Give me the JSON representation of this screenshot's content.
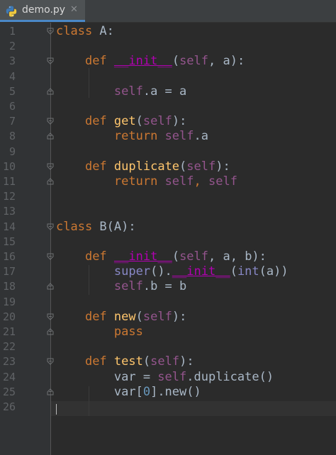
{
  "tab": {
    "filename": "demo.py",
    "close_glyph": "✕",
    "icon": "python-file-icon"
  },
  "editor": {
    "current_line": 26,
    "lines": [
      {
        "n": "1",
        "fold": "start",
        "tokens": [
          {
            "t": "class",
            "c": "kw"
          },
          {
            "t": " A:",
            "c": "tx"
          }
        ]
      },
      {
        "n": "2",
        "fold": "",
        "tokens": []
      },
      {
        "n": "3",
        "fold": "start",
        "tokens": [
          {
            "t": "    ",
            "c": "tx"
          },
          {
            "t": "def",
            "c": "kw"
          },
          {
            "t": " ",
            "c": "tx"
          },
          {
            "t": "__init__",
            "c": "mg",
            "u": true
          },
          {
            "t": "(",
            "c": "tx"
          },
          {
            "t": "self",
            "c": "sf"
          },
          {
            "t": ", a):",
            "c": "tx"
          }
        ]
      },
      {
        "n": "4",
        "fold": "",
        "tokens": []
      },
      {
        "n": "5",
        "fold": "end",
        "tokens": [
          {
            "t": "        ",
            "c": "tx"
          },
          {
            "t": "self",
            "c": "sf"
          },
          {
            "t": ".a = a",
            "c": "tx"
          }
        ]
      },
      {
        "n": "6",
        "fold": "",
        "tokens": []
      },
      {
        "n": "7",
        "fold": "start",
        "tokens": [
          {
            "t": "    ",
            "c": "tx"
          },
          {
            "t": "def",
            "c": "kw"
          },
          {
            "t": " ",
            "c": "tx"
          },
          {
            "t": "get",
            "c": "fn"
          },
          {
            "t": "(",
            "c": "tx"
          },
          {
            "t": "self",
            "c": "sf"
          },
          {
            "t": "):",
            "c": "tx"
          }
        ]
      },
      {
        "n": "8",
        "fold": "end",
        "tokens": [
          {
            "t": "        ",
            "c": "tx"
          },
          {
            "t": "return",
            "c": "kw"
          },
          {
            "t": " ",
            "c": "tx"
          },
          {
            "t": "self",
            "c": "sf"
          },
          {
            "t": ".a",
            "c": "tx"
          }
        ]
      },
      {
        "n": "9",
        "fold": "",
        "tokens": []
      },
      {
        "n": "10",
        "fold": "start",
        "tokens": [
          {
            "t": "    ",
            "c": "tx"
          },
          {
            "t": "def",
            "c": "kw"
          },
          {
            "t": " ",
            "c": "tx"
          },
          {
            "t": "duplicate",
            "c": "fn"
          },
          {
            "t": "(",
            "c": "tx"
          },
          {
            "t": "self",
            "c": "sf"
          },
          {
            "t": "):",
            "c": "tx"
          }
        ]
      },
      {
        "n": "11",
        "fold": "end",
        "tokens": [
          {
            "t": "        ",
            "c": "tx"
          },
          {
            "t": "return",
            "c": "kw"
          },
          {
            "t": " ",
            "c": "tx"
          },
          {
            "t": "self",
            "c": "sf"
          },
          {
            "t": ", ",
            "c": "kw"
          },
          {
            "t": "self",
            "c": "sf"
          }
        ]
      },
      {
        "n": "12",
        "fold": "",
        "tokens": []
      },
      {
        "n": "13",
        "fold": "",
        "tokens": []
      },
      {
        "n": "14",
        "fold": "start",
        "tokens": [
          {
            "t": "class",
            "c": "kw"
          },
          {
            "t": " B(A):",
            "c": "tx"
          }
        ]
      },
      {
        "n": "15",
        "fold": "",
        "tokens": []
      },
      {
        "n": "16",
        "fold": "start",
        "tokens": [
          {
            "t": "    ",
            "c": "tx"
          },
          {
            "t": "def",
            "c": "kw"
          },
          {
            "t": " ",
            "c": "tx"
          },
          {
            "t": "__init__",
            "c": "mg",
            "u": true
          },
          {
            "t": "(",
            "c": "tx"
          },
          {
            "t": "self",
            "c": "sf"
          },
          {
            "t": ", a, b):",
            "c": "tx"
          }
        ]
      },
      {
        "n": "17",
        "fold": "",
        "tokens": [
          {
            "t": "        ",
            "c": "tx"
          },
          {
            "t": "super",
            "c": "bi"
          },
          {
            "t": "().",
            "c": "tx"
          },
          {
            "t": "__init__",
            "c": "mg",
            "u": true
          },
          {
            "t": "(",
            "c": "tx"
          },
          {
            "t": "int",
            "c": "bi"
          },
          {
            "t": "(a))",
            "c": "tx"
          }
        ]
      },
      {
        "n": "18",
        "fold": "end",
        "tokens": [
          {
            "t": "        ",
            "c": "tx"
          },
          {
            "t": "self",
            "c": "sf"
          },
          {
            "t": ".b = b",
            "c": "tx"
          }
        ]
      },
      {
        "n": "19",
        "fold": "",
        "tokens": []
      },
      {
        "n": "20",
        "fold": "start",
        "tokens": [
          {
            "t": "    ",
            "c": "tx"
          },
          {
            "t": "def",
            "c": "kw"
          },
          {
            "t": " ",
            "c": "tx"
          },
          {
            "t": "new",
            "c": "fn"
          },
          {
            "t": "(",
            "c": "tx"
          },
          {
            "t": "self",
            "c": "sf"
          },
          {
            "t": "):",
            "c": "tx"
          }
        ]
      },
      {
        "n": "21",
        "fold": "end",
        "tokens": [
          {
            "t": "        ",
            "c": "tx"
          },
          {
            "t": "pass",
            "c": "kw"
          }
        ]
      },
      {
        "n": "22",
        "fold": "",
        "tokens": []
      },
      {
        "n": "23",
        "fold": "start",
        "tokens": [
          {
            "t": "    ",
            "c": "tx"
          },
          {
            "t": "def",
            "c": "kw"
          },
          {
            "t": " ",
            "c": "tx"
          },
          {
            "t": "test",
            "c": "fn"
          },
          {
            "t": "(",
            "c": "tx"
          },
          {
            "t": "self",
            "c": "sf"
          },
          {
            "t": "):",
            "c": "tx"
          }
        ]
      },
      {
        "n": "24",
        "fold": "",
        "tokens": [
          {
            "t": "        var = ",
            "c": "tx"
          },
          {
            "t": "self",
            "c": "sf"
          },
          {
            "t": ".duplicate()",
            "c": "tx"
          }
        ]
      },
      {
        "n": "25",
        "fold": "end",
        "tokens": [
          {
            "t": "        var[",
            "c": "tx"
          },
          {
            "t": "0",
            "c": "nm"
          },
          {
            "t": "].new()",
            "c": "tx"
          }
        ]
      },
      {
        "n": "26",
        "fold": "",
        "tokens": []
      }
    ]
  },
  "colors": {
    "editor_bg": "#2b2b2b",
    "gutter_bg": "#313335",
    "keyword": "#cc7832",
    "function": "#ffc66d",
    "self": "#94558d",
    "magic": "#b200b2",
    "number": "#6897bb",
    "builtin": "#8888c6",
    "text": "#a9b7c6"
  }
}
